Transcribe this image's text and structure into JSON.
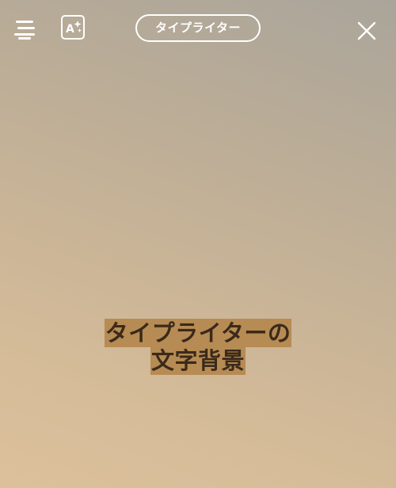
{
  "toolbar": {
    "menu_icon": "hamburger-menu-icon",
    "effects_icon": "text-effects-sparkle-icon",
    "effects_icon_letter": "A",
    "style_label": "タイプライター",
    "close_icon": "close-x-icon"
  },
  "canvas": {
    "text_lines": [
      "タイプライターの",
      "文字背景"
    ],
    "highlight_color": "#b78b54",
    "text_color": "#3a2a1a"
  },
  "colors": {
    "icon_color": "#ffffff"
  }
}
